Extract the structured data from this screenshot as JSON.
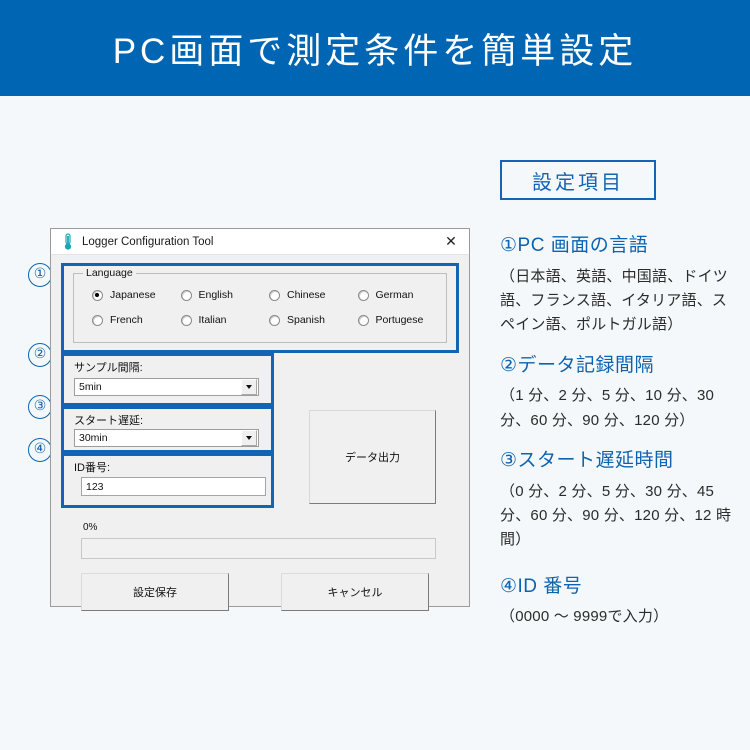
{
  "header": {
    "title": "PC画面で測定条件を簡単設定",
    "bg_color": "#0066b3"
  },
  "callouts": {
    "one": "①",
    "two": "②",
    "three": "③",
    "four": "④"
  },
  "dialog": {
    "title": "Logger Configuration Tool",
    "title_icon": "thermometer-icon",
    "close_label": "✕",
    "language_group": {
      "legend": "Language",
      "options": [
        {
          "label": "Japanese",
          "selected": true
        },
        {
          "label": "English",
          "selected": false
        },
        {
          "label": "Chinese",
          "selected": false
        },
        {
          "label": "German",
          "selected": false
        },
        {
          "label": "French",
          "selected": false
        },
        {
          "label": "Italian",
          "selected": false
        },
        {
          "label": "Spanish",
          "selected": false
        },
        {
          "label": "Portugese",
          "selected": false
        }
      ]
    },
    "sample_interval": {
      "label": "サンプル間隔:",
      "value": "5min"
    },
    "start_delay": {
      "label": "スタート遅延:",
      "value": "30min"
    },
    "id_number": {
      "label": "ID番号:",
      "value": "123"
    },
    "data_output_button": "データ出力",
    "progress": {
      "label": "0%",
      "percent": 0
    },
    "save_button": "設定保存",
    "cancel_button": "キャンセル",
    "highlight_color": "#1464b4"
  },
  "side_panel": {
    "heading": "設定項目",
    "accent_color": "#1464b4",
    "items": [
      {
        "title": "①PC 画面の言語",
        "desc": "（日本語、英語、中国語、ドイツ語、フランス語、イタリア語、スペイン語、ポルトガル語）"
      },
      {
        "title": "②データ記録間隔",
        "desc": "（1 分、2 分、5 分、10 分、30 分、60 分、90 分、120 分）"
      },
      {
        "title": "③スタート遅延時間",
        "desc": "（0 分、2 分、5 分、30 分、45 分、60 分、90 分、120 分、12 時間）"
      },
      {
        "title": "④ID 番号",
        "desc": "（0000 ～ 9999で入力）"
      }
    ]
  }
}
